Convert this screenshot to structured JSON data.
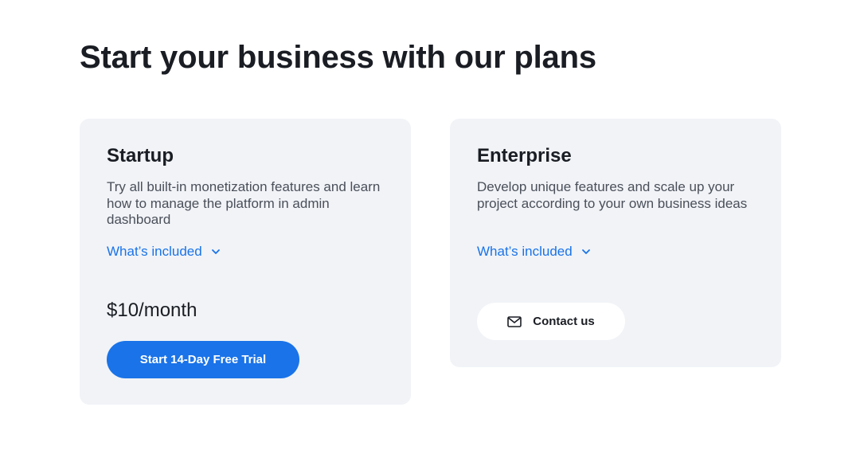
{
  "page": {
    "title": "Start your business with our plans"
  },
  "plans": [
    {
      "name": "Startup",
      "description": "Try all built-in monetization features and learn how to manage the platform in admin dashboard",
      "included_label": "What’s included",
      "price": "$10/month",
      "cta_label": "Start 14-Day Free Trial"
    },
    {
      "name": "Enterprise",
      "description": "Develop unique features and scale up your project according to your own business ideas",
      "included_label": "What’s included",
      "cta_label": "Contact us",
      "cta_icon": "mail-icon"
    }
  ],
  "colors": {
    "accent": "#1a73e8",
    "card_background": "#f1f3f7",
    "heading": "#1a1d23",
    "body_text": "#4a4f59"
  }
}
